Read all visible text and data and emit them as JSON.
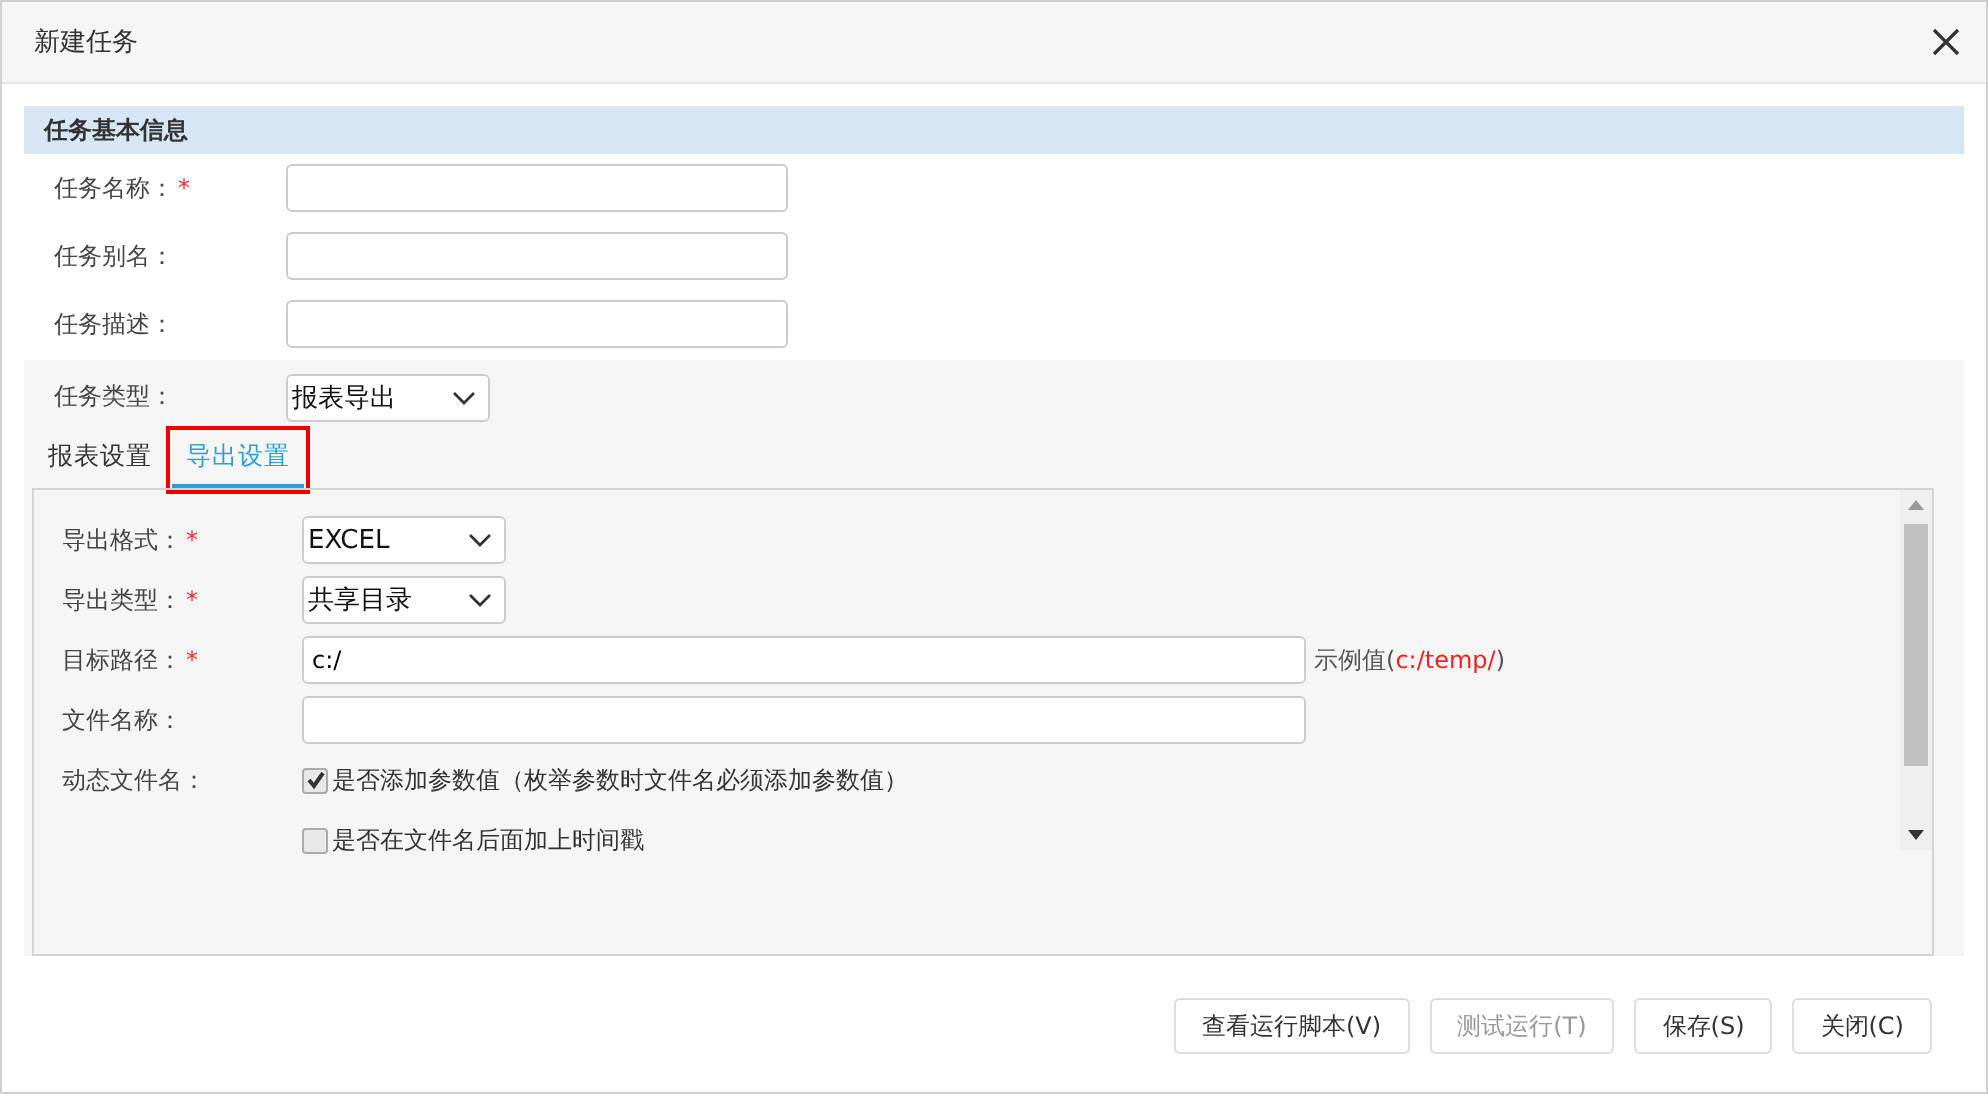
{
  "window": {
    "title": "新建任务"
  },
  "section": {
    "title": "任务基本信息"
  },
  "basic_fields": [
    {
      "label": "任务名称：",
      "required_mark": "*",
      "kind": "input"
    },
    {
      "label": "任务别名：",
      "kind": "input"
    },
    {
      "label": "任务描述：",
      "kind": "input"
    }
  ],
  "task_type": {
    "label": "任务类型：",
    "value": "报表导出"
  },
  "tabs": [
    {
      "label": "报表设置",
      "selected": false,
      "highlighted": false
    },
    {
      "label": "导出设置",
      "selected": true,
      "highlighted": true
    }
  ],
  "export_fields": [
    {
      "kind": "select",
      "label": "导出格式：",
      "required_mark": "*",
      "value": "EXCEL"
    },
    {
      "kind": "select",
      "label": "导出类型：",
      "required_mark": "*",
      "value": "共享目录"
    },
    {
      "kind": "input",
      "label": "目标路径：",
      "required_mark": "*",
      "value": "c:/",
      "hint_prefix": "示例值(",
      "hint_value": "c:/temp/",
      "hint_suffix": ")"
    },
    {
      "kind": "input",
      "label": "文件名称："
    },
    {
      "kind": "checkbox",
      "label": "动态文件名：",
      "checked": true,
      "text": "是否添加参数值（枚举参数时文件名必须添加参数值）"
    },
    {
      "kind": "checkbox",
      "checked": false,
      "text": "是否在文件名后面加上时间戳"
    }
  ],
  "buttons": [
    {
      "label": "查看运行脚本(V)",
      "disabled": false
    },
    {
      "label": "测试运行(T)",
      "disabled": true
    },
    {
      "label": "保存(S)",
      "disabled": false
    },
    {
      "label": "关闭(C)",
      "disabled": false
    }
  ]
}
